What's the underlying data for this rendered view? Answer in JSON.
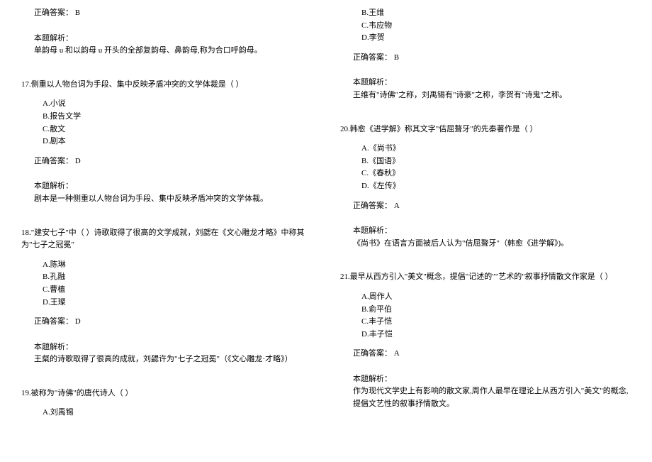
{
  "left": {
    "q16_answer_label": "正确答案：",
    "q16_answer_value": "B",
    "q16_analysis_label": "本题解析：",
    "q16_analysis_text": "单韵母 u 和以韵母 u 开头的全部复韵母、鼻韵母,称为合口呼韵母。",
    "q17_text": "17.侧重以人物台词为手段、集中反映矛盾冲突的文学体裁是（ ）",
    "q17_options": {
      "a": "A.小说",
      "b": "B.报告文学",
      "c": "C.散文",
      "d": "D.剧本"
    },
    "q17_answer_label": "正确答案：",
    "q17_answer_value": "D",
    "q17_analysis_label": "本题解析：",
    "q17_analysis_text": "剧本是一种侧重以人物台词为手段、集中反映矛盾冲突的文学体裁。",
    "q18_text": "18.\"建安七子\"中（ ）诗歌取得了很高的文学成就，刘勰在《文心雕龙才略》中称其为\"七子之冠冕\"",
    "q18_options": {
      "a": "A.陈琳",
      "b": "B.孔融",
      "c": "C.曹植",
      "d": "D.王璨"
    },
    "q18_answer_label": "正确答案：",
    "q18_answer_value": "D",
    "q18_analysis_label": "本题解析：",
    "q18_analysis_text": "王粲的诗歌取得了很高的成就，刘勰许为\"七子之冠冕\"（《文心雕龙·才略》）",
    "q19_text": "19.被称为\"诗佛\"的唐代诗人（ ）",
    "q19_options": {
      "a": "A.刘禹锡"
    }
  },
  "right": {
    "q19_options_cont": {
      "b": "B.王维",
      "c": "C.韦应物",
      "d": "D.李贺"
    },
    "q19_answer_label": "正确答案：",
    "q19_answer_value": "B",
    "q19_analysis_label": "本题解析：",
    "q19_analysis_text": "王维有\"诗佛\"之称，刘禹锡有\"诗豪\"之称，李贺有\"诗鬼\"之称。",
    "q20_text": "20.韩愈《进学解》称其文字\"佶屈聱牙\"的先秦著作是（ ）",
    "q20_options": {
      "a": "A.《尚书》",
      "b": "B.《国语》",
      "c": "C.《春秋》",
      "d": "D.《左传》"
    },
    "q20_answer_label": "正确答案：",
    "q20_answer_value": "A",
    "q20_analysis_label": "本题解析：",
    "q20_analysis_text": "《尚书》在语言方面被后人认为\"佶屈聱牙\"（韩愈《进学解》)。",
    "q21_text": "21.最早从西方引入\"美文\"概念，提倡\"记述的\"\"艺术的\"叙事抒情散文作家是（ ）",
    "q21_options": {
      "a": "A.周作人",
      "b": "B.俞平伯",
      "c": "C.丰子恺",
      "d": "D.丰子恺"
    },
    "q21_answer_label": "正确答案：",
    "q21_answer_value": "A",
    "q21_analysis_label": "本题解析：",
    "q21_analysis_text": "作为现代文学史上有影响的散文家,周作人最早在理论上从西方引入\"美文\"的概念,提倡文艺性的叙事抒情散文。"
  }
}
